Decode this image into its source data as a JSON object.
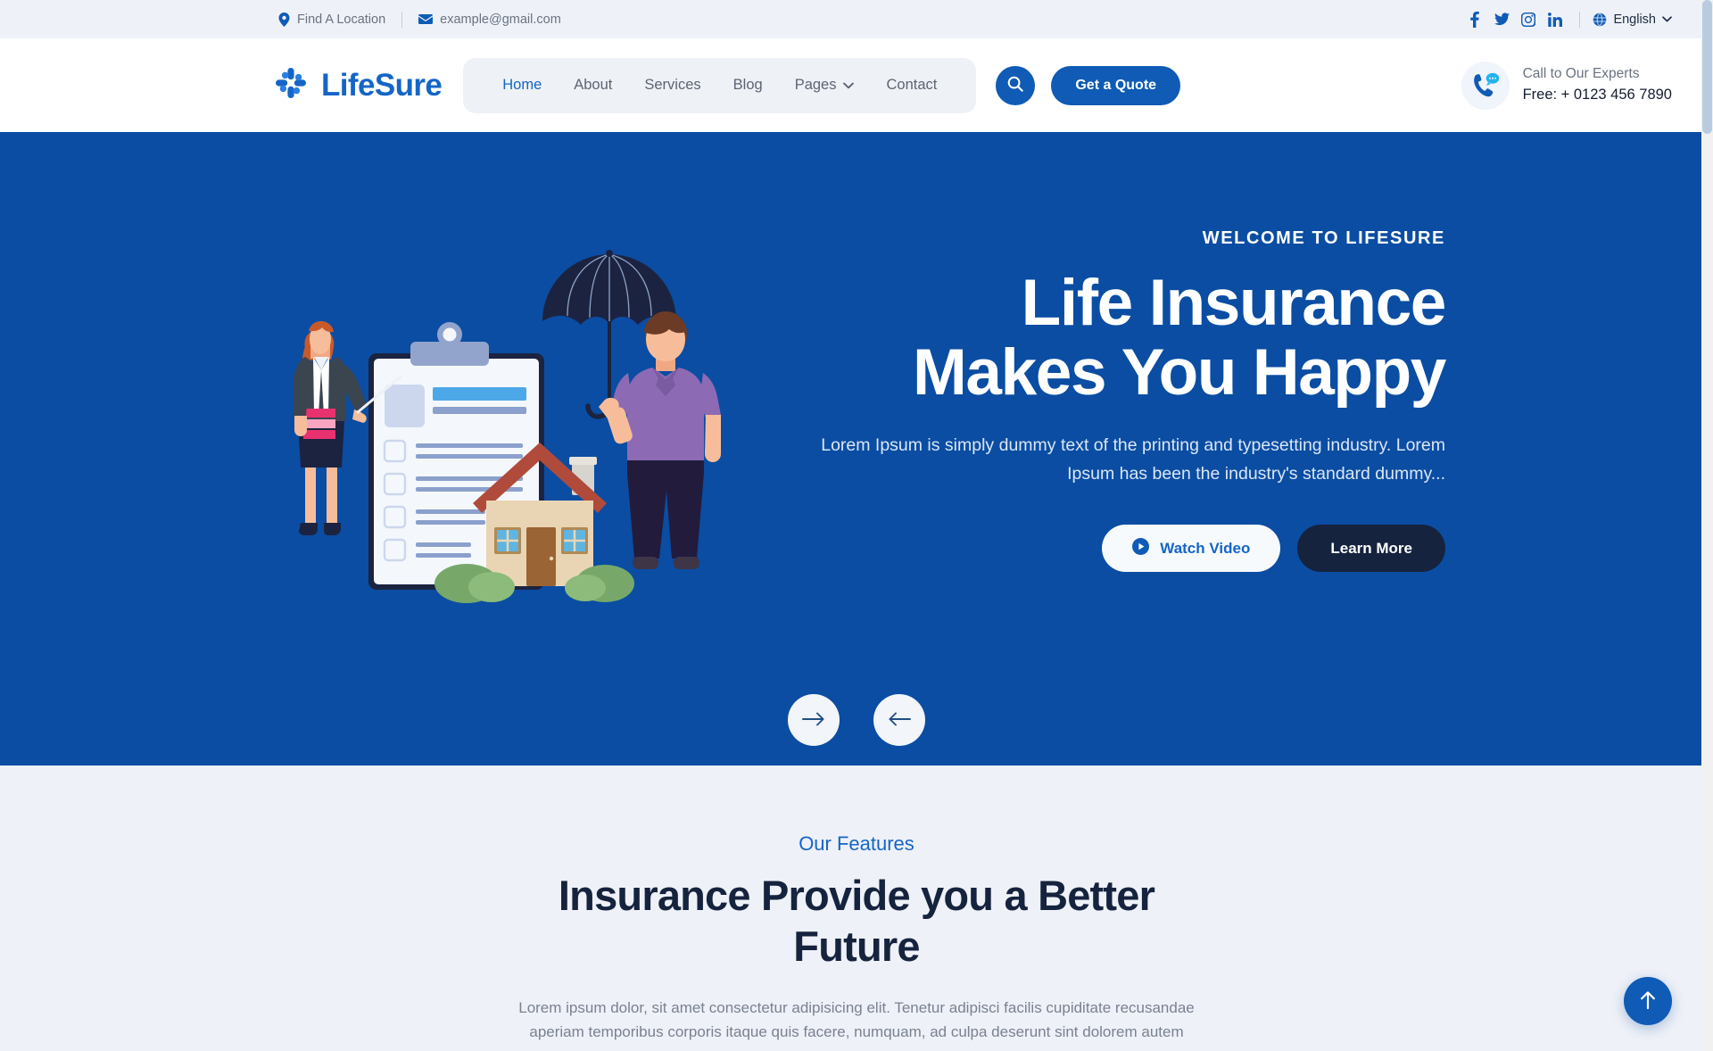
{
  "topbar": {
    "location": "Find A Location",
    "email": "example@gmail.com",
    "socials": [
      {
        "name": "facebook-icon",
        "label": "Facebook"
      },
      {
        "name": "twitter-icon",
        "label": "Twitter"
      },
      {
        "name": "instagram-icon",
        "label": "Instagram"
      },
      {
        "name": "linkedin-icon",
        "label": "LinkedIn"
      }
    ],
    "language": "English"
  },
  "header": {
    "brand": "LifeSure",
    "nav": [
      {
        "label": "Home",
        "active": true,
        "dropdown": false
      },
      {
        "label": "About",
        "active": false,
        "dropdown": false
      },
      {
        "label": "Services",
        "active": false,
        "dropdown": false
      },
      {
        "label": "Blog",
        "active": false,
        "dropdown": false
      },
      {
        "label": "Pages",
        "active": false,
        "dropdown": true
      },
      {
        "label": "Contact",
        "active": false,
        "dropdown": false
      }
    ],
    "quote_label": "Get a Quote",
    "expert_label": "Call to Our Experts",
    "expert_phone": "Free: + 0123 456 7890"
  },
  "hero": {
    "eyebrow": "WELCOME TO LIFESURE",
    "title_line1": "Life Insurance",
    "title_line2": "Makes You Happy",
    "subtitle": "Lorem Ipsum is simply dummy text of the printing and typesetting industry. Lorem Ipsum has been the industry's standard dummy...",
    "watch_label": "Watch Video",
    "learn_label": "Learn More"
  },
  "features": {
    "eyebrow": "Our Features",
    "title": "Insurance Provide you a Better Future",
    "description": "Lorem ipsum dolor, sit amet consectetur adipisicing elit. Tenetur adipisci facilis cupiditate recusandae aperiam temporibus corporis itaque quis facere, numquam, ad culpa deserunt sint dolorem autem"
  },
  "colors": {
    "brand_blue": "#1565c8",
    "hero_blue": "#0a4da3",
    "accent_blue": "#0f5bb5",
    "dark_navy": "#16233e",
    "page_bg": "#eef1f7",
    "topbar_bg": "#eef2f8"
  }
}
